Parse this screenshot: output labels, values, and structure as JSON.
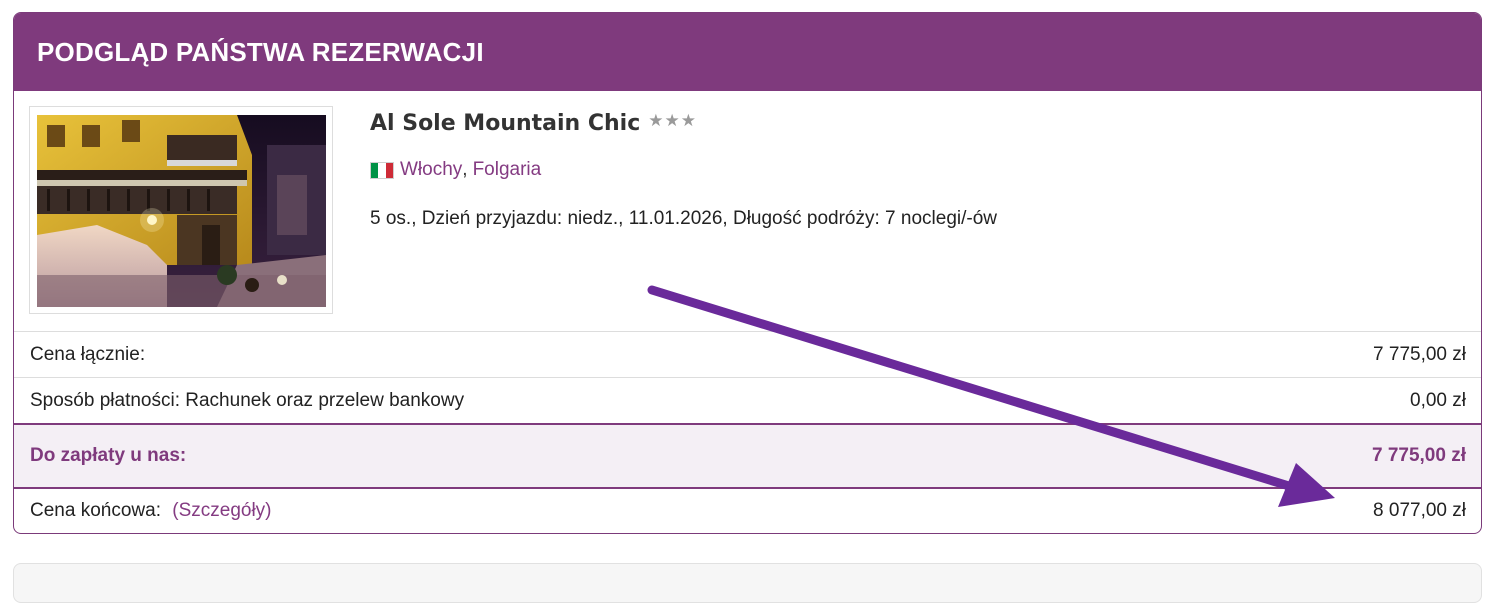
{
  "header": {
    "title": "PODGLĄD PAŃSTWA REZERWACJI"
  },
  "hotel": {
    "name": "Al Sole Mountain Chic",
    "stars": "★★★",
    "country": "Włochy",
    "city": "Folgaria",
    "separator": ",",
    "trip_info": "5 os., Dzień przyjazdu: niedz., 11.01.2026, Długość podróży: 7 noclegi/-ów",
    "flag_colors": [
      "#009246",
      "#ffffff",
      "#ce2b37"
    ]
  },
  "price_rows": [
    {
      "label": "Cena łącznie:",
      "value": "7 775,00 zł"
    },
    {
      "label": "Sposób płatności: Rachunek oraz przelew bankowy",
      "value": "0,00 zł"
    },
    {
      "label": "Do zapłaty u nas:",
      "value": "7 775,00 zł"
    },
    {
      "label": "Cena końcowa:",
      "link": "(Szczegóły)",
      "value": "8 077,00 zł"
    }
  ],
  "colors": {
    "accent": "#7f3a7d",
    "total_bg": "#f4eff5",
    "arrow": "#6a2a9a"
  }
}
